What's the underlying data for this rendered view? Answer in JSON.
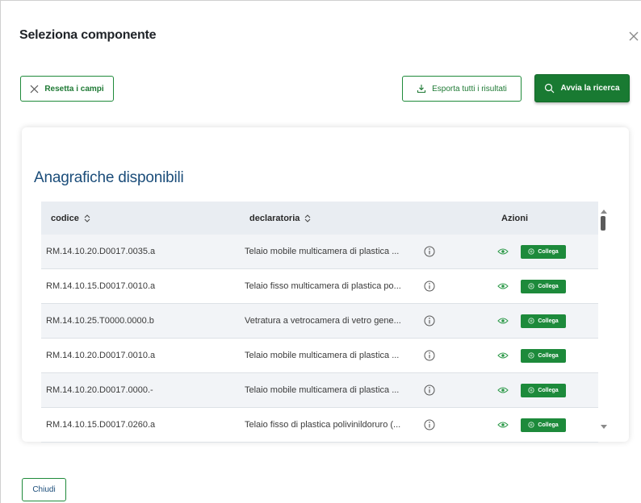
{
  "dialog": {
    "title": "Seleziona componente",
    "reset_label": "Resetta i campi",
    "export_label": "Esporta tutti i risultati",
    "search_label": "Avvia la ricerca",
    "close_label": "Chiudi"
  },
  "section": {
    "title": "Anagrafiche disponibili"
  },
  "table": {
    "headers": {
      "code": "codice",
      "description": "declaratoria",
      "actions": "Azioni"
    },
    "link_label": "Collega",
    "rows": [
      {
        "code": "RM.14.10.20.D0017.0035.a",
        "description": "Telaio mobile multicamera di plastica ..."
      },
      {
        "code": "RM.14.10.15.D0017.0010.a",
        "description": "Telaio fisso multicamera di plastica po..."
      },
      {
        "code": "RM.14.10.25.T0000.0000.b",
        "description": "Vetratura a vetrocamera di vetro gene..."
      },
      {
        "code": "RM.14.10.20.D0017.0010.a",
        "description": "Telaio mobile multicamera di plastica ..."
      },
      {
        "code": "RM.14.10.20.D0017.0000.-",
        "description": "Telaio mobile multicamera di plastica ..."
      },
      {
        "code": "RM.14.10.15.D0017.0260.a",
        "description": "Telaio fisso di plastica polivinildoruro (..."
      }
    ]
  },
  "icons": {
    "close": "close-icon",
    "reset": "x-icon",
    "export": "download-icon",
    "search": "search-icon",
    "sort": "sort-icon",
    "info": "info-icon",
    "view": "eye-icon",
    "link": "link-circle-icon"
  },
  "colors": {
    "primary_green": "#197a32",
    "title_blue": "#1b4d7a",
    "header_bg": "#e9edf2"
  }
}
